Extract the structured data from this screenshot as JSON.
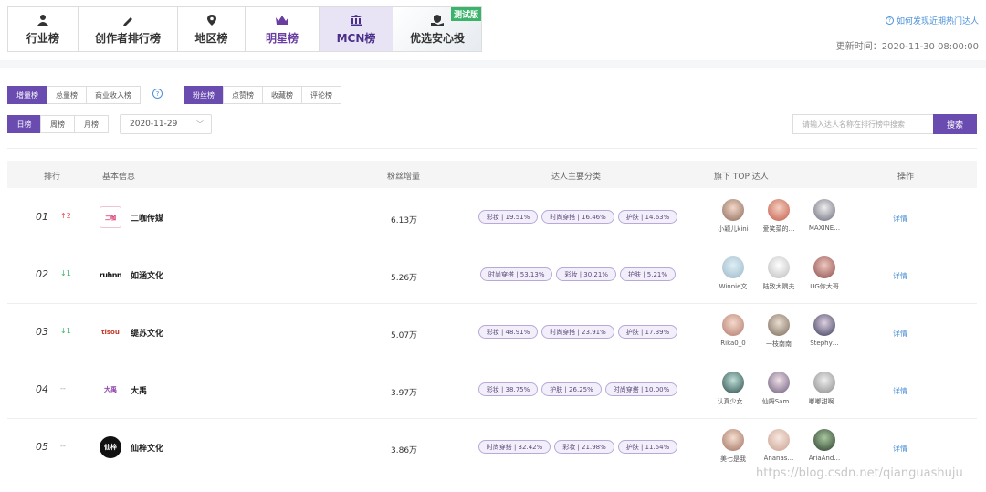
{
  "nav": {
    "tabs": [
      {
        "label": "行业榜",
        "icon": "person-icon"
      },
      {
        "label": "创作者排行榜",
        "icon": "pen-icon"
      },
      {
        "label": "地区榜",
        "icon": "location-pin-icon"
      },
      {
        "label": "明星榜",
        "icon": "crown-icon"
      },
      {
        "label": "MCN榜",
        "icon": "building-icon"
      },
      {
        "label": "优选安心投",
        "icon": "hand-shield-icon",
        "badge": "测试版"
      }
    ],
    "help_link": "如何发现近期热门达人",
    "update_time": "更新时间：2020-11-30 08:00:00"
  },
  "filters": {
    "type_tabs": [
      "增量榜",
      "总量榜",
      "商业收入榜"
    ],
    "metric_tabs": [
      "粉丝榜",
      "点赞榜",
      "收藏榜",
      "评论榜"
    ],
    "period_tabs": [
      "日榜",
      "周榜",
      "月榜"
    ],
    "date": "2020-11-29",
    "search_placeholder": "请输入达人名称在排行榜中搜索",
    "search_button": "搜索"
  },
  "table": {
    "headers": {
      "rank": "排行",
      "info": "基本信息",
      "fans": "粉丝增量",
      "cats": "达人主要分类",
      "talents": "旗下 TOP 达人",
      "action": "操作"
    },
    "rows": [
      {
        "rank": "01",
        "trend": "↑2",
        "trend_type": "up",
        "logo_text": "二咖",
        "name": "二咖传媒",
        "fans": "6.13万",
        "cats": [
          "彩妆 | 19.51%",
          "时尚穿搭 | 16.46%",
          "护肤 | 14.63%"
        ],
        "talents": [
          "小颖儿kini",
          "爱笑菜的…",
          "MAXINE…"
        ],
        "action": "详情"
      },
      {
        "rank": "02",
        "trend": "↓1",
        "trend_type": "down",
        "logo_text": "ruhnn",
        "name": "如涵文化",
        "fans": "5.26万",
        "cats": [
          "时尚穿搭 | 53.13%",
          "彩妆 | 30.21%",
          "护肤 | 5.21%"
        ],
        "talents": [
          "Winnie文",
          "陆致大隅夫",
          "UG你大哥"
        ],
        "action": "详情"
      },
      {
        "rank": "03",
        "trend": "↓1",
        "trend_type": "down",
        "logo_text": "tisou",
        "name": "缇苏文化",
        "fans": "5.07万",
        "cats": [
          "彩妆 | 48.91%",
          "时尚穿搭 | 23.91%",
          "护肤 | 17.39%"
        ],
        "talents": [
          "Rika0_0",
          "一枝南南",
          "Stephy…"
        ],
        "action": "详情"
      },
      {
        "rank": "04",
        "trend": "--",
        "trend_type": "flat",
        "logo_text": "大禹",
        "name": "大禹",
        "fans": "3.97万",
        "cats": [
          "彩妆 | 38.75%",
          "护肤 | 26.25%",
          "时尚穿搭 | 10.00%"
        ],
        "talents": [
          "认真少女…",
          "仙姆Sam…",
          "嘟嘟甜啊…"
        ],
        "action": "详情"
      },
      {
        "rank": "05",
        "trend": "--",
        "trend_type": "flat",
        "logo_text": "仙梓",
        "name": "仙梓文化",
        "fans": "3.86万",
        "cats": [
          "时尚穿搭 | 32.42%",
          "彩妆 | 21.98%",
          "护肤 | 11.54%"
        ],
        "talents": [
          "美七是我",
          "Ananas…",
          "AriaAnd…"
        ],
        "action": "详情"
      }
    ]
  },
  "watermark": "https://blog.csdn.net/qianguashuju"
}
